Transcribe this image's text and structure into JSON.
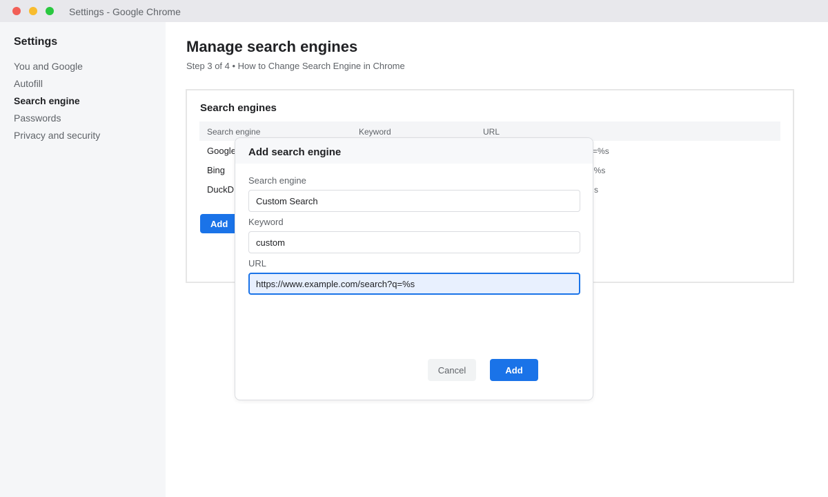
{
  "window": {
    "title": "Settings - Google Chrome"
  },
  "sidebar": {
    "title": "Settings",
    "items": [
      {
        "label": "You and Google",
        "active": false
      },
      {
        "label": "Autofill",
        "active": false
      },
      {
        "label": "Search engine",
        "active": true
      },
      {
        "label": "Passwords",
        "active": false
      },
      {
        "label": "Privacy and security",
        "active": false
      }
    ]
  },
  "main": {
    "title": "Manage search engines",
    "subtitle": "Step 3 of 4 • How to Change Search Engine in Chrome",
    "card": {
      "title": "Search engines",
      "columns": [
        "Search engine",
        "Keyword",
        "URL"
      ],
      "rows": [
        {
          "engine": "Google",
          "url_visible": "h?q=%s"
        },
        {
          "engine": "Bing",
          "url_visible": "q=%s"
        },
        {
          "engine": "DuckD",
          "url_visible": "s"
        }
      ],
      "add_label": "Add"
    }
  },
  "dialog": {
    "title": "Add search engine",
    "fields": {
      "engine": {
        "label": "Search engine",
        "value": "Custom Search"
      },
      "keyword": {
        "label": "Keyword",
        "value": "custom"
      },
      "url": {
        "label": "URL",
        "value": "https://www.example.com/search?q=%s"
      }
    },
    "cancel_label": "Cancel",
    "add_label": "Add"
  },
  "colors": {
    "accent": "#1a73e8",
    "sidebar_bg": "#f5f6f8",
    "titlebar_bg": "#e8e8ec"
  }
}
